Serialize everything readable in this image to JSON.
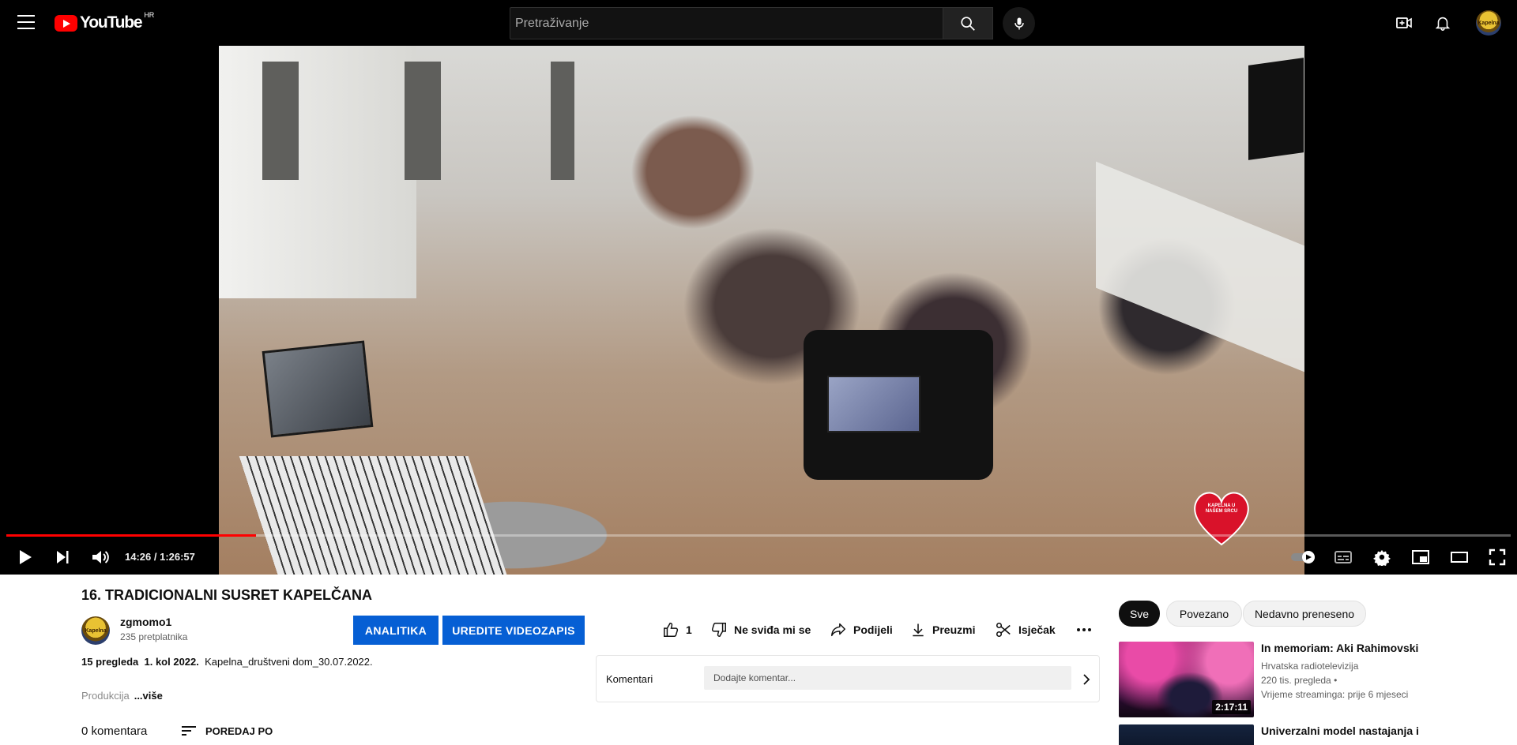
{
  "header": {
    "logo_text": "YouTube",
    "region": "HR",
    "search_placeholder": "Pretraživanje",
    "avatar_text": "Kapelna"
  },
  "player": {
    "time_display": "14:26 / 1:26:57",
    "progress_fraction": 0.166,
    "watermark_text": "KAPELNA U NAŠEM SRCU"
  },
  "video": {
    "title": "16. TRADICIONALNI SUSRET KAPELČANA",
    "channel": {
      "name": "zgmomo1",
      "subscribers": "235 pretplatnika",
      "avatar_text": "Kapelna"
    },
    "buttons": {
      "analytics": "ANALITIKA",
      "edit": "UREDITE VIDEOZAPIS"
    },
    "actions": {
      "like_count": "1",
      "dislike": "Ne sviđa mi se",
      "share": "Podijeli",
      "download": "Preuzmi",
      "clip": "Isječak"
    },
    "description": {
      "views": "15 pregleda",
      "date": "1. kol 2022.",
      "text": "Kapelna_društveni dom_30.07.2022.",
      "snippet": "Produkcija",
      "more": "...više"
    }
  },
  "comments": {
    "count": "0 komentara",
    "sort": "POREDAJ PO",
    "panel_title": "Komentari",
    "input_placeholder": "Dodajte komentar..."
  },
  "chips": [
    "Sve",
    "Povezano",
    "Nedavno preneseno"
  ],
  "recommendations": [
    {
      "title": "In memoriam: Aki Rahimovski",
      "channel": "Hrvatska radiotelevizija",
      "views": "220 tis. pregleda •",
      "time": "Vrijeme streaminga: prije 6 mjeseci",
      "duration": "2:17:11"
    },
    {
      "title": "Univerzalni model nastajanja i"
    }
  ],
  "colors": {
    "accent_red": "#ff0000",
    "button_blue": "#065fd4",
    "chip_active": "#0f0f0f"
  },
  "icons": {
    "menu": "hamburger-icon",
    "search": "search-icon",
    "mic": "mic-icon",
    "create": "create-video-icon",
    "notifications": "bell-icon",
    "play": "play-icon",
    "next": "next-icon",
    "volume": "volume-icon",
    "autoplay": "autoplay-toggle-icon",
    "captions": "captions-icon",
    "settings": "gear-icon",
    "miniplayer": "miniplayer-icon",
    "theater": "theater-icon",
    "fullscreen": "fullscreen-icon"
  }
}
